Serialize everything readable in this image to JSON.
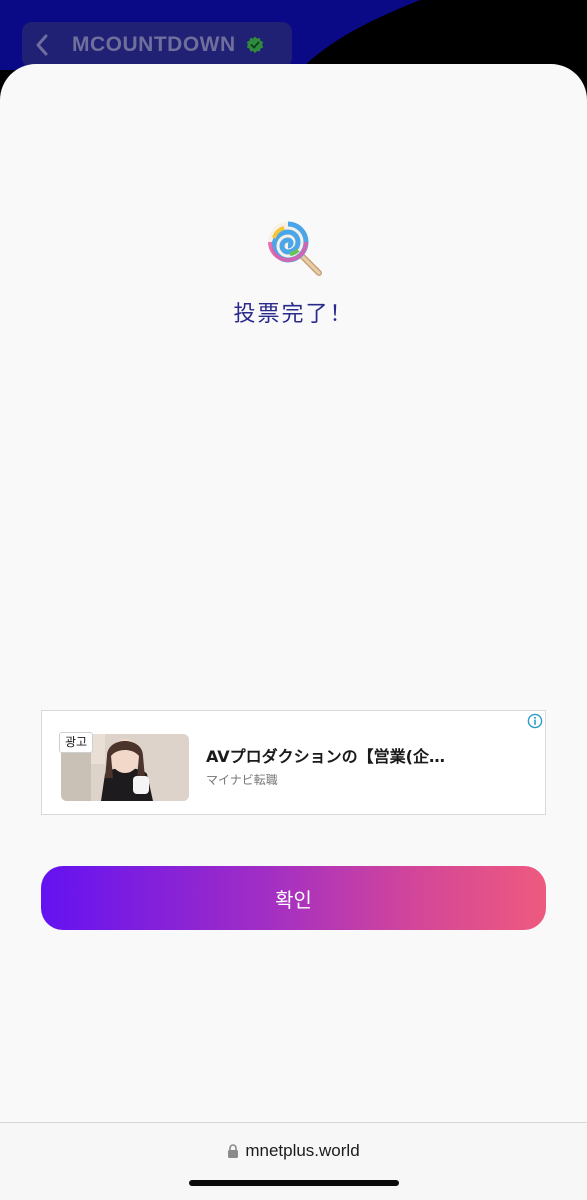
{
  "header": {
    "title": "MCOUNTDOWN",
    "back_icon": "chevron-left-icon",
    "verified_icon": "verified-badge-icon"
  },
  "result": {
    "icon": "lollipop-icon",
    "message": "投票完了！"
  },
  "ad": {
    "badge": "광고",
    "title": "AVプロダクションの【営業(企…",
    "source": "マイナビ転職",
    "info_icon": "info-icon"
  },
  "confirm_button": {
    "label": "확인",
    "gradient": [
      "#6412f2",
      "#ee5a7e"
    ]
  },
  "browser": {
    "url": "mnetplus.world",
    "lock_icon": "lock-icon"
  },
  "colors": {
    "message_text": "#2a2a8e",
    "header_bg": "#0a0a86",
    "sheet_bg": "#f9f9f9"
  }
}
